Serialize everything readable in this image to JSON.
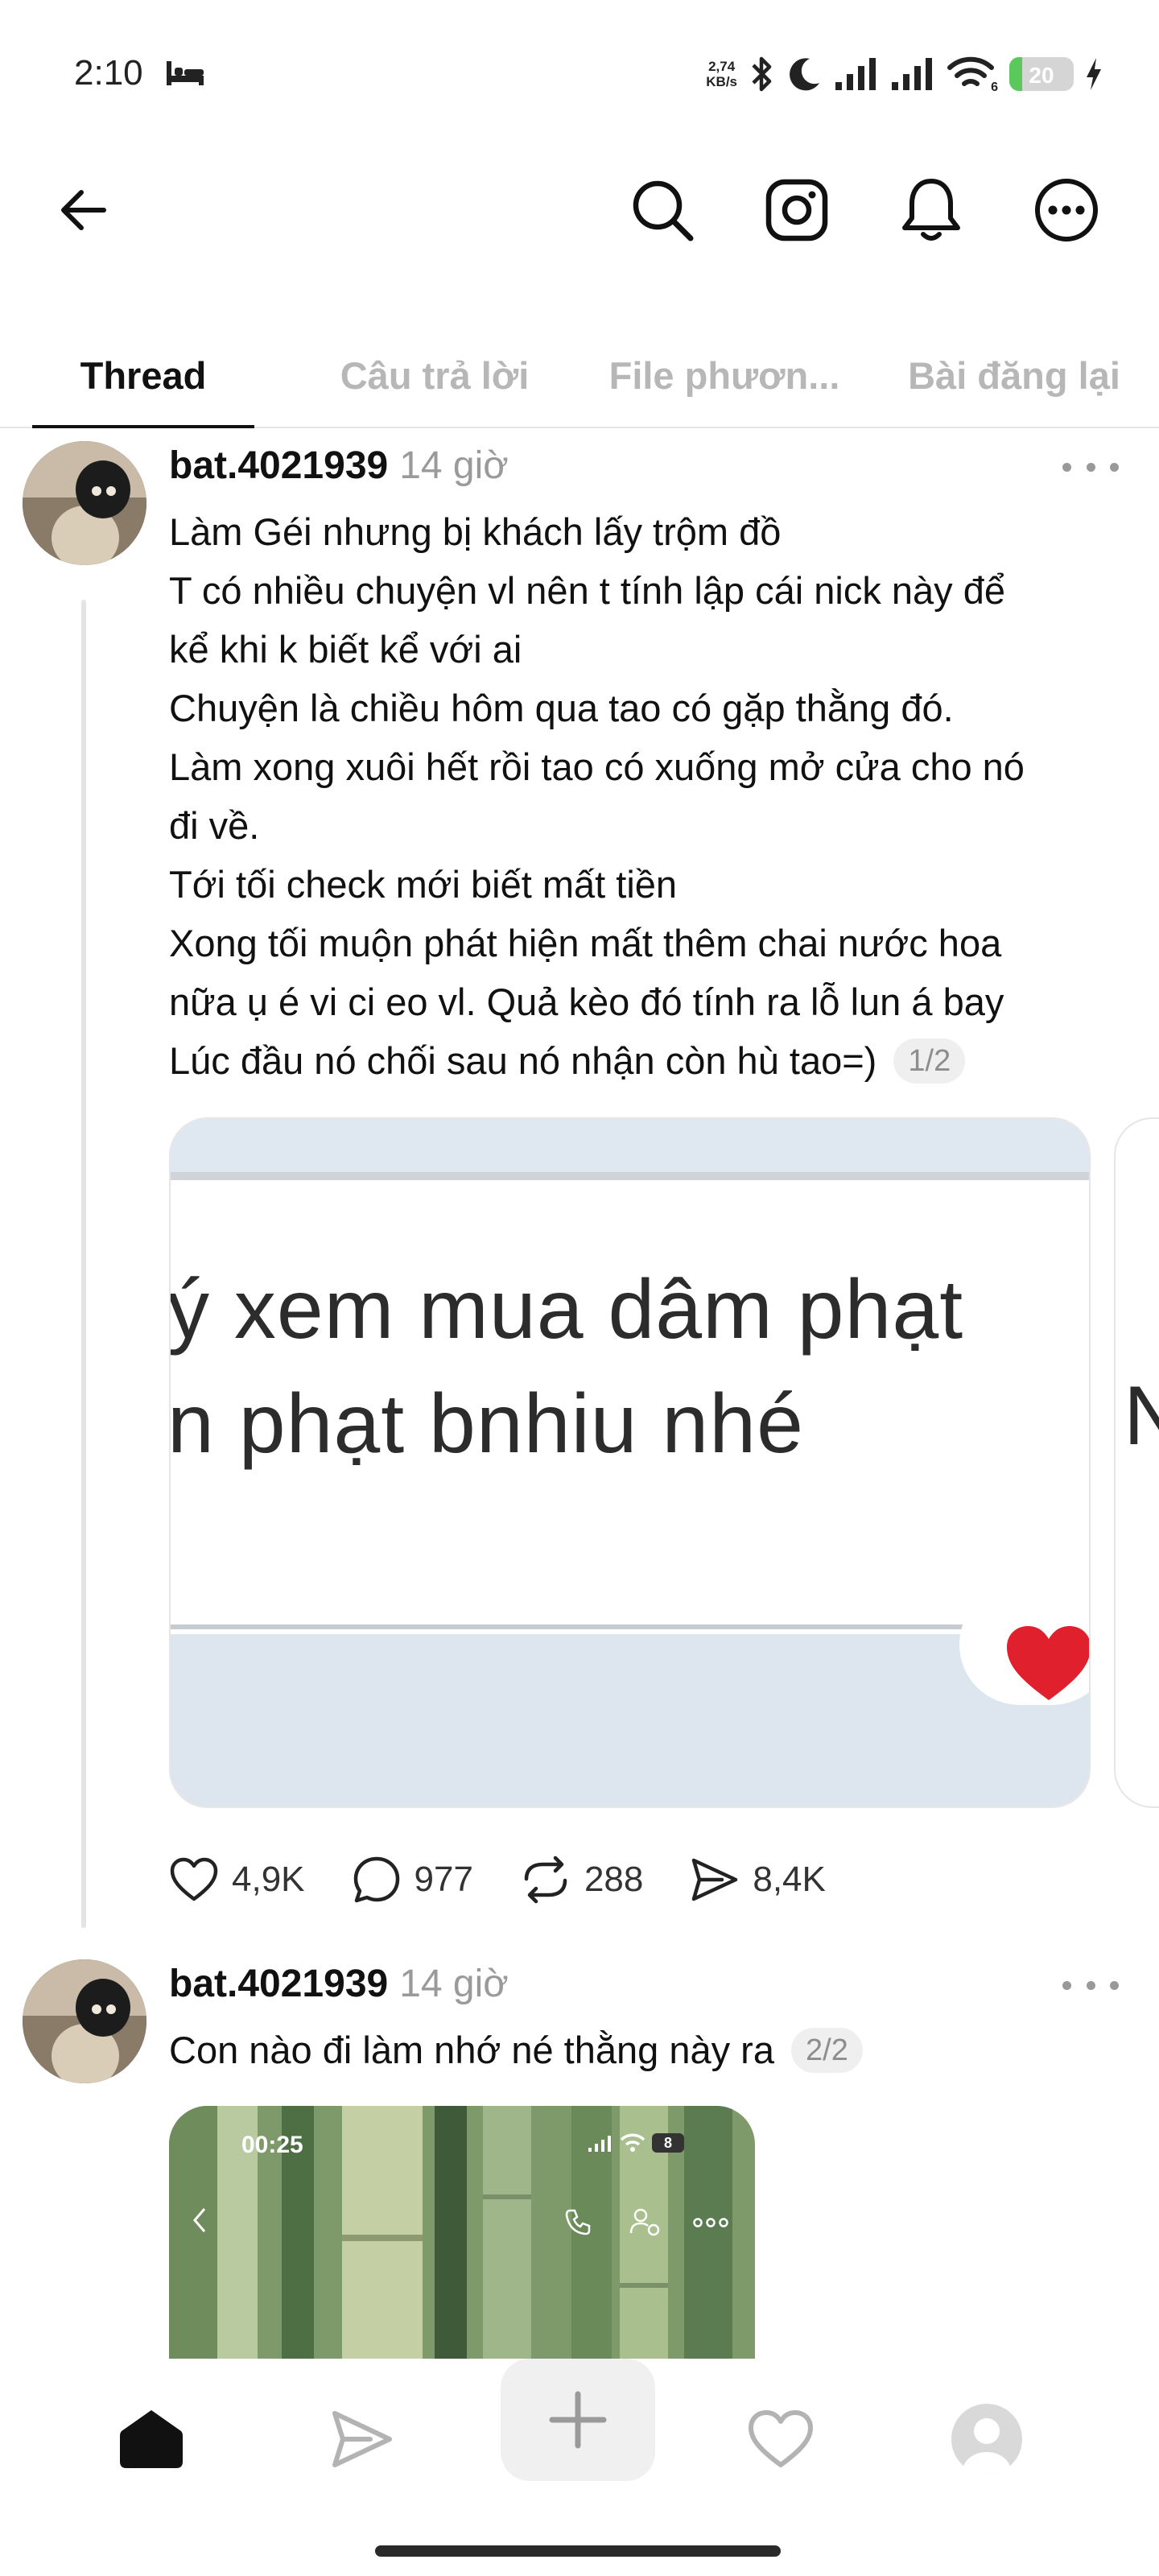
{
  "status_bar": {
    "time": "2:10",
    "net_speed_value": "2,74",
    "net_speed_unit": "KB/s",
    "wifi_badge": "6",
    "battery": "20",
    "battery_level": 0.2
  },
  "tabs": [
    {
      "label": "Thread",
      "active": true
    },
    {
      "label": "Câu trả lời",
      "active": false
    },
    {
      "label": "File phươn...",
      "active": false
    },
    {
      "label": "Bài đăng lại",
      "active": false
    }
  ],
  "posts": [
    {
      "username": "bat.4021939",
      "time": "14 giờ",
      "lines": [
        "Làm Géi nhưng bị khách lấy trộm đồ",
        "T có nhiều chuyện vl nên t tính lập cái nick này để",
        "kể khi k biết kể với ai",
        "Chuyện là chiều hôm qua tao có gặp thằng đó.",
        "Làm xong xuôi hết rồi tao có xuống mở cửa cho nó",
        "đi về.",
        "Tới tối check mới biết mất tiền",
        "Xong tối muộn phát hiện mất thêm chai nước hoa",
        "nữa ụ é vi ci eo vl. Quả kèo đó tính ra lỗ lun á bay",
        "Lúc đầu nó chối sau nó nhận còn hù tao=)"
      ],
      "page": "1/2",
      "media_text_1": "ý xem mua dâm phạt",
      "media_text_2": "n phạt bnhiu nhé",
      "media_peek_text": "N",
      "likes": "4,9K",
      "replies": "977",
      "reposts": "288",
      "shares": "8,4K"
    },
    {
      "username": "bat.4021939",
      "time": "14 giờ",
      "text": "Con nào đi làm nhớ né thằng này ra",
      "page": "2/2",
      "media_time": "00:25",
      "media_battery": "8"
    }
  ]
}
